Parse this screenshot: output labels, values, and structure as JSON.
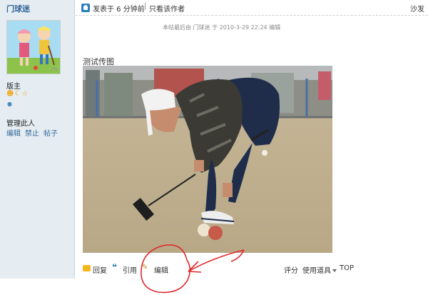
{
  "sidebar": {
    "username": "门球迷",
    "rank": "版主",
    "manage": {
      "title": "管理此人",
      "links": [
        "编辑",
        "禁止",
        "帖子"
      ]
    }
  },
  "post": {
    "posted": "发表于 6 分钟前",
    "separator": "|",
    "author_only": "只看该作者",
    "floor": "沙发",
    "edit_note": "本帖最后由 门球迷 于 2010-3-29 22:24 编辑",
    "text": "测试传图"
  },
  "footer": {
    "reply": "回复",
    "quote": "引用",
    "edit": "编辑",
    "rate": "评分",
    "tools": "使用道具",
    "top": "TOP"
  },
  "colors": {
    "sidebar_bg": "#e5edf2",
    "link": "#336699",
    "annotation": "#e0282b"
  },
  "icons": [
    "post-icon",
    "medal-icons",
    "reply-icon",
    "quote-icon",
    "edit-pencil-icon",
    "dropdown-arrow-icon"
  ]
}
